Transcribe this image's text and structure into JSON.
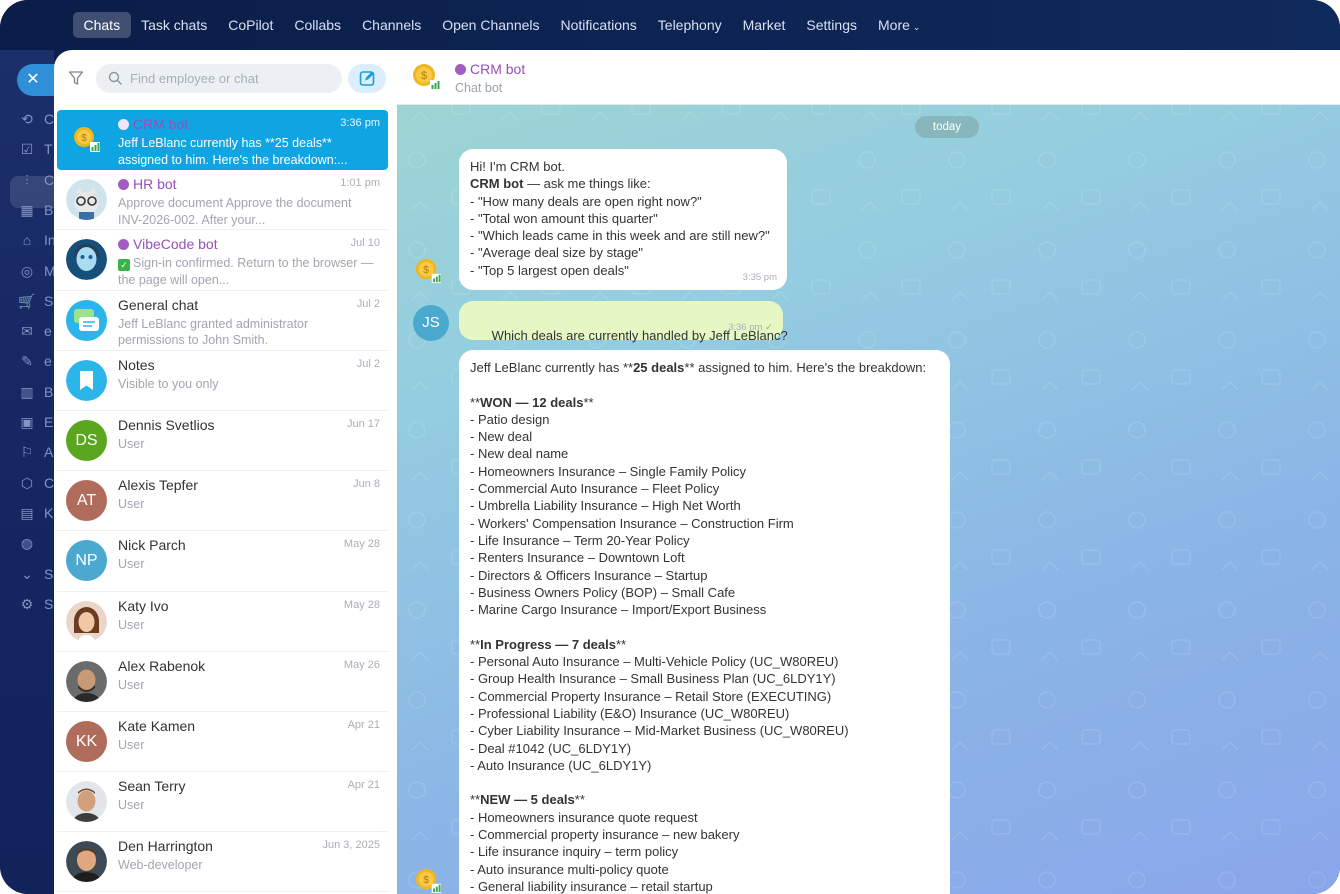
{
  "nav": {
    "items": [
      "Chats",
      "Task chats",
      "CoPilot",
      "Collabs",
      "Channels",
      "Open Channels",
      "Notifications",
      "Telephony",
      "Market",
      "Settings"
    ],
    "more": "More",
    "active_index": 0
  },
  "rail": {
    "letters": [
      "C",
      "T",
      "C",
      "B",
      "In",
      "M",
      "S",
      "e",
      "e",
      "B",
      "E",
      "A",
      "C",
      "K",
      "",
      "S",
      "S"
    ]
  },
  "search": {
    "placeholder": "Find employee or chat"
  },
  "chats": [
    {
      "name": "CRM bot",
      "bot": true,
      "time": "3:36 pm",
      "preview": "Jeff LeBlanc currently has **25 deals** assigned to him. Here's the breakdown:...",
      "active": true
    },
    {
      "name": "HR bot",
      "bot": true,
      "time": "1:01 pm",
      "preview": "Approve document Approve the document INV-2026-002. After your..."
    },
    {
      "name": "VibeCode bot",
      "bot": true,
      "time": "Jul 10",
      "preview": "Sign-in confirmed. Return to the browser — the page will open..."
    },
    {
      "name": "General chat",
      "time": "Jul 2",
      "preview": "Jeff LeBlanc granted administrator permissions to John Smith."
    },
    {
      "name": "Notes",
      "time": "Jul 2",
      "preview": "Visible to you only"
    },
    {
      "name": "Dennis Svetlios",
      "time": "Jun 17",
      "preview": "User",
      "initials": "DS",
      "color": "#5aa61f"
    },
    {
      "name": "Alexis Tepfer",
      "time": "Jun 8",
      "preview": "User",
      "initials": "AT",
      "color": "#b06c5a"
    },
    {
      "name": "Nick Parch",
      "time": "May 28",
      "preview": "User",
      "initials": "NP",
      "color": "#4ba8cf"
    },
    {
      "name": "Katy Ivo",
      "time": "May 28",
      "preview": "User"
    },
    {
      "name": "Alex Rabenok",
      "time": "May 26",
      "preview": "User"
    },
    {
      "name": "Kate Kamen",
      "time": "Apr 21",
      "preview": "User",
      "initials": "KK",
      "color": "#b06c5a"
    },
    {
      "name": "Sean Terry",
      "time": "Apr 21",
      "preview": "User"
    },
    {
      "name": "Den Harrington",
      "time": "Jun 3, 2025",
      "preview": "Web-developer"
    }
  ],
  "header": {
    "title": "CRM bot",
    "subtitle": "Chat bot"
  },
  "date_divider": "today",
  "messages": {
    "m1": {
      "lines": [
        "Hi! I'm CRM bot.",
        "— ask me things like:",
        "- \"How many deals are open right now?\"",
        "- \"Total won amount this quarter\"",
        "- \"Which leads came in this week and are still new?\"",
        "- \"Average deal size by stage\"",
        "- \"Top 5 largest open deals\""
      ],
      "bold": "CRM bot",
      "time": "3:35 pm"
    },
    "m2": {
      "text": "Which deals are currently handled by Jeff LeBlanc?",
      "time": "3:36 pm",
      "author_initials": "JS"
    },
    "m3": {
      "intro_a": "Jeff LeBlanc currently has **",
      "intro_bold": "25 deals",
      "intro_b": "** assigned to him. Here's the breakdown:",
      "sections": [
        {
          "head_a": "**",
          "head_bold": "WON — 12 deals",
          "head_b": "**",
          "items": [
            "- Patio design",
            "- New deal",
            "- New deal name",
            "- Homeowners Insurance – Single Family Policy",
            "- Commercial Auto Insurance – Fleet Policy",
            "- Umbrella Liability Insurance – High Net Worth",
            "- Workers' Compensation Insurance – Construction Firm",
            "- Life Insurance – Term 20-Year Policy",
            "- Renters Insurance – Downtown Loft",
            "- Directors & Officers Insurance – Startup",
            "- Business Owners Policy (BOP) – Small Cafe",
            "- Marine Cargo Insurance – Import/Export Business"
          ]
        },
        {
          "head_a": "**",
          "head_bold": "In Progress — 7 deals",
          "head_b": "**",
          "items": [
            "- Personal Auto Insurance – Multi-Vehicle Policy (UC_W80REU)",
            "- Group Health Insurance – Small Business Plan (UC_6LDY1Y)",
            "- Commercial Property Insurance – Retail Store (EXECUTING)",
            "- Professional Liability (E&O) Insurance (UC_W80REU)",
            "- Cyber Liability Insurance – Mid-Market Business (UC_W80REU)",
            "- Deal #1042 (UC_6LDY1Y)",
            "- Auto Insurance (UC_6LDY1Y)"
          ]
        },
        {
          "head_a": "**",
          "head_bold": "NEW — 5 deals",
          "head_b": "**",
          "items": [
            "- Homeowners insurance quote request",
            "- Commercial property insurance – new bakery",
            "- Life insurance inquiry – term policy",
            "- Auto insurance multi-policy quote",
            "- General liability insurance – retail startup"
          ]
        }
      ]
    }
  }
}
